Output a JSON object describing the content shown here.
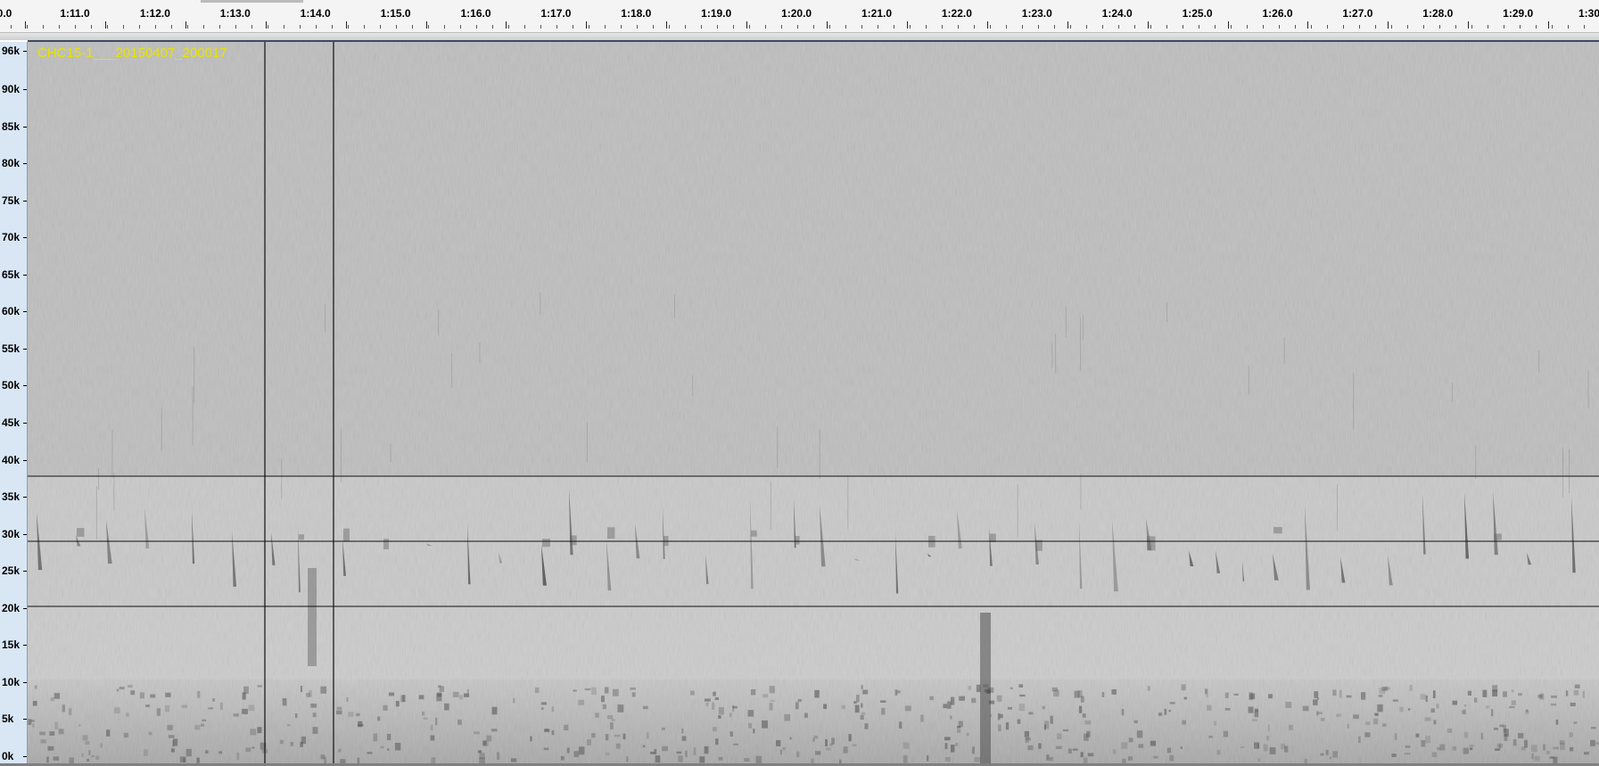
{
  "track": {
    "name": "CHC15-1___20150407_200017"
  },
  "ruler": {
    "start_label": "0.0",
    "labels": [
      "1:11.0",
      "1:12.0",
      "1:13.0",
      "1:14.0",
      "1:15.0",
      "1:16.0",
      "1:17.0",
      "1:18.0",
      "1:19.0",
      "1:20.0",
      "1:21.0",
      "1:22.0",
      "1:23.0",
      "1:24.0",
      "1:25.0",
      "1:26.0",
      "1:27.0",
      "1:28.0",
      "1:29.0",
      "1:30"
    ]
  },
  "frequency_axis": {
    "labels": [
      "96k",
      "90k",
      "85k",
      "80k",
      "75k",
      "70k",
      "65k",
      "60k",
      "55k",
      "50k",
      "45k",
      "40k",
      "35k",
      "30k",
      "25k",
      "20k",
      "15k",
      "10k",
      "5k",
      "0k"
    ]
  },
  "colors": {
    "spectrogram_background": "#bebebe",
    "low_band": "#cacaca",
    "track_name": "#e8e400",
    "axis_background": "#d9e6f4"
  }
}
